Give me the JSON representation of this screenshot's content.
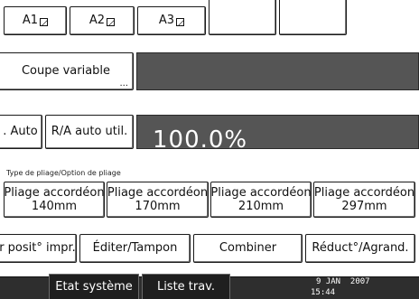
{
  "paper_sizes": [
    {
      "label": "A1",
      "icon": "paper-orientation-icon"
    },
    {
      "label": "A2",
      "icon": "paper-orientation-icon"
    },
    {
      "label": "A3",
      "icon": "paper-orientation-icon"
    }
  ],
  "cut": {
    "label": "Coupe variable",
    "more": "..."
  },
  "reduce_enlarge": {
    "auto_label": ". Auto",
    "auto_util_label": "R/A auto util.",
    "ratio": "100.0%"
  },
  "fold": {
    "caption": "Type de pliage/Option de pliage",
    "options": [
      {
        "line1": "Pliage accordéon",
        "line2": "140mm"
      },
      {
        "line1": "Pliage accordéon",
        "line2": "170mm"
      },
      {
        "line1": "Pliage accordéon",
        "line2": "210mm"
      },
      {
        "line1": "Pliage accordéon",
        "line2": "297mm"
      }
    ]
  },
  "functions": {
    "position": "r posit° impr.",
    "edit": "Éditer/Tampon",
    "combine": "Combiner",
    "reduce": "Réduct°/Agrand."
  },
  "status_bar": {
    "system_status": "Etat système",
    "job_list": "Liste trav.",
    "date": "9 JAN  2007",
    "time": "15:44"
  },
  "colors": {
    "dark_field": "#555555",
    "bottom_bar": "#2e2e2e"
  }
}
